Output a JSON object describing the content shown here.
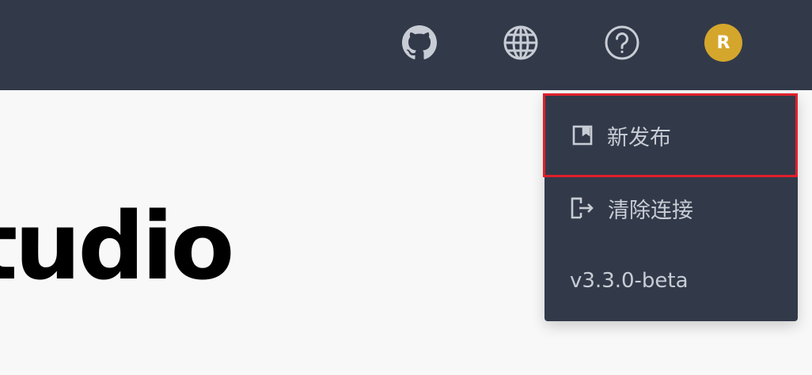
{
  "header": {
    "icons": [
      "github-icon",
      "globe-icon",
      "help-icon"
    ],
    "avatar_initial": "R",
    "avatar_color": "#d4a62c",
    "background": "#323a4a"
  },
  "main": {
    "hero_text": "tudio"
  },
  "menu": {
    "items": [
      {
        "label": "新发布",
        "icon": "release-icon",
        "highlighted": true
      },
      {
        "label": "清除连接",
        "icon": "logout-icon",
        "highlighted": false
      }
    ],
    "version": "v3.3.0-beta",
    "highlight_color": "#e0202a"
  }
}
